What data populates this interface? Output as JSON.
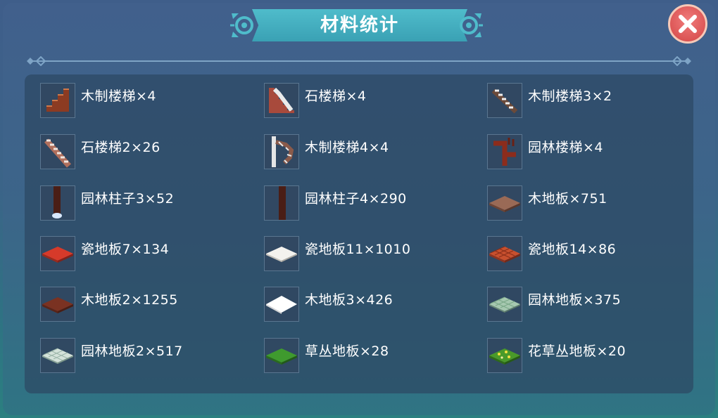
{
  "title": "材料统计",
  "items": [
    {
      "label": "木制楼梯×4",
      "icon": "wooden-stairs-icon"
    },
    {
      "label": "石楼梯×4",
      "icon": "stone-stairs-icon"
    },
    {
      "label": "木制楼梯3×2",
      "icon": "wooden-stairs-3-icon"
    },
    {
      "label": "石楼梯2×26",
      "icon": "stone-stairs-2-icon"
    },
    {
      "label": "木制楼梯4×4",
      "icon": "spiral-stairs-icon"
    },
    {
      "label": "园林楼梯×4",
      "icon": "garden-stairs-icon"
    },
    {
      "label": "园林柱子3×52",
      "icon": "garden-pillar-3-icon"
    },
    {
      "label": "园林柱子4×290",
      "icon": "garden-pillar-4-icon"
    },
    {
      "label": "木地板×751",
      "icon": "wood-floor-icon"
    },
    {
      "label": "瓷地板7×134",
      "icon": "tile-floor-7-icon"
    },
    {
      "label": "瓷地板11×1010",
      "icon": "tile-floor-11-icon"
    },
    {
      "label": "瓷地板14×86",
      "icon": "tile-floor-14-icon"
    },
    {
      "label": "木地板2×1255",
      "icon": "wood-floor-2-icon"
    },
    {
      "label": "木地板3×426",
      "icon": "wood-floor-3-icon"
    },
    {
      "label": "园林地板×375",
      "icon": "garden-floor-icon"
    },
    {
      "label": "园林地板2×517",
      "icon": "garden-floor-2-icon"
    },
    {
      "label": "草丛地板×28",
      "icon": "grass-floor-icon"
    },
    {
      "label": "花草丛地板×20",
      "icon": "flower-grass-floor-icon"
    }
  ]
}
